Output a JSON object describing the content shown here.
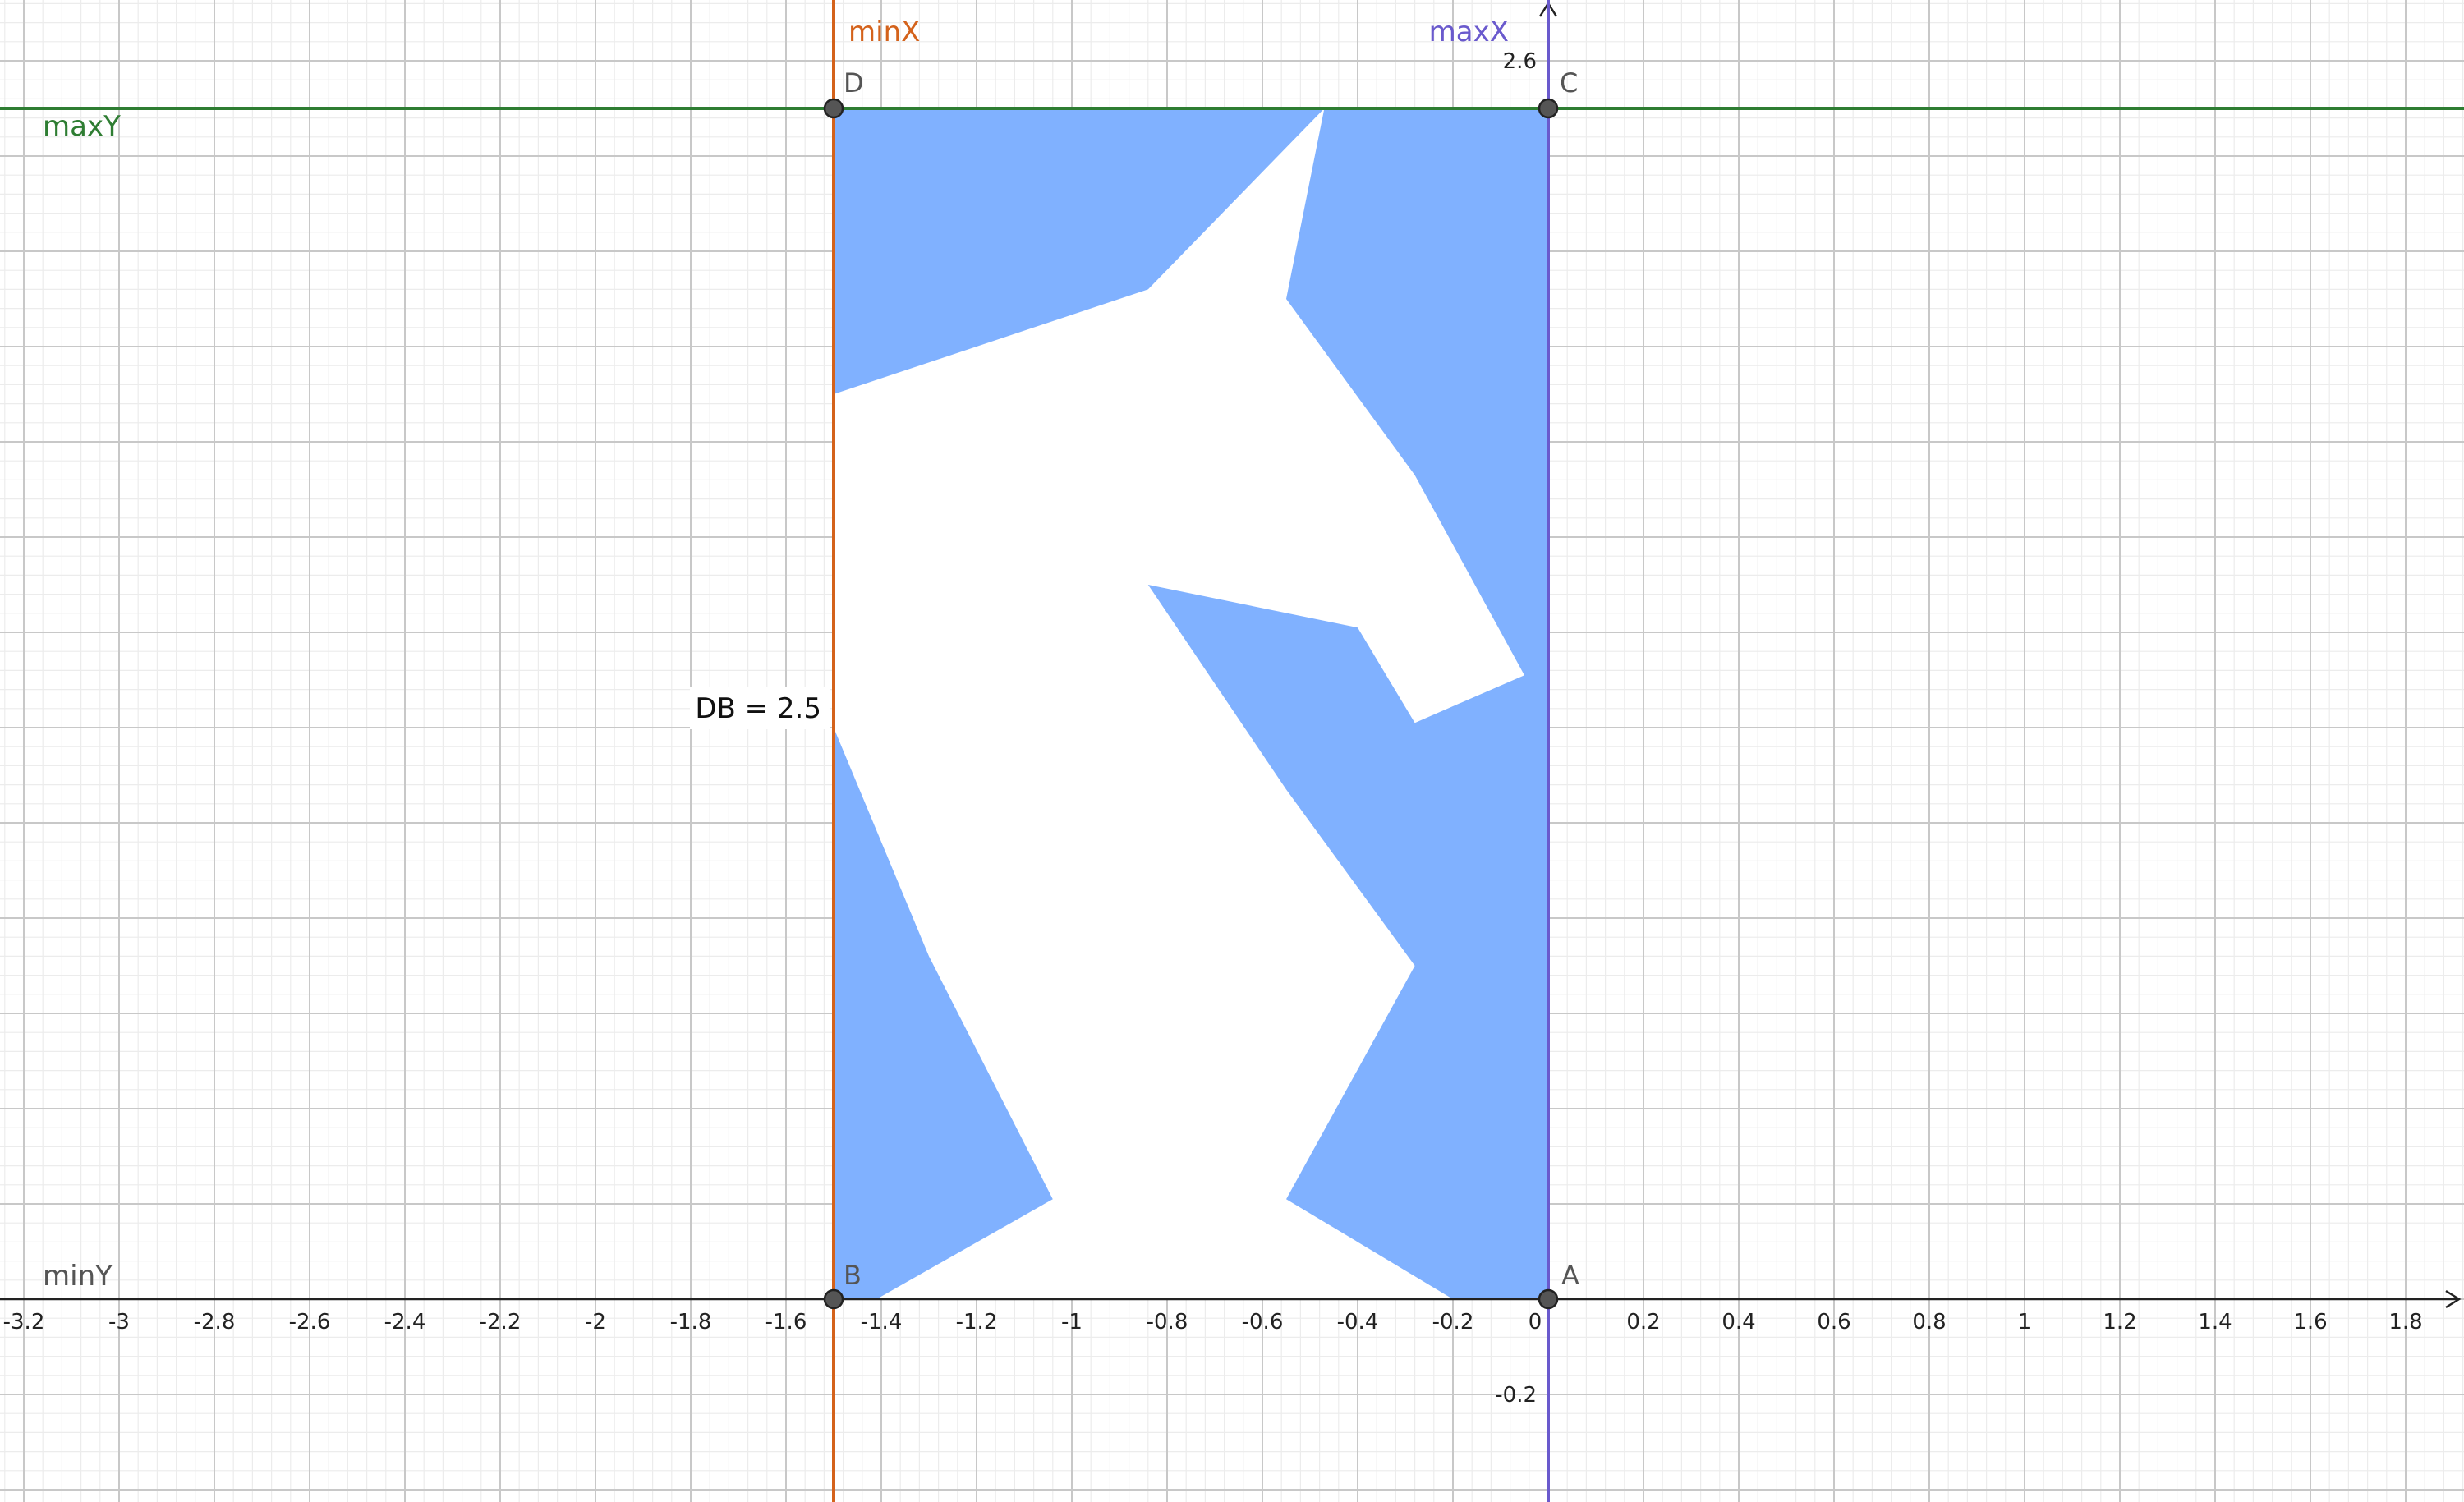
{
  "app": "GeoGebra graphing view",
  "axis_ticks": {
    "x": [
      "-3.2",
      "-3",
      "-2.8",
      "-2.6",
      "-2.4",
      "-2.2",
      "-2",
      "-1.8",
      "-1.6",
      "-1.4",
      "-1.2",
      "-1",
      "-0.8",
      "-0.6",
      "-0.4",
      "-0.2",
      "0",
      "0.2",
      "0.4",
      "0.6",
      "0.8",
      "1",
      "1.2",
      "1.4",
      "1.6",
      "1.8"
    ],
    "y": [
      "2.6",
      "-0.2"
    ]
  },
  "lines": {
    "minX": {
      "label": "minX",
      "color": "#d4621b"
    },
    "maxX": {
      "label": "maxX",
      "color": "#6a5acd"
    },
    "maxY": {
      "label": "maxY",
      "color": "#2e7d32"
    },
    "minY": {
      "label": "minY",
      "color": "#555555"
    }
  },
  "points": {
    "A": {
      "label": "A",
      "x": 0,
      "y": 0
    },
    "B": {
      "label": "B",
      "x": -1.5,
      "y": 0
    },
    "C": {
      "label": "C",
      "x": 0,
      "y": 2.5
    },
    "D": {
      "label": "D",
      "x": -1.5,
      "y": 2.5
    }
  },
  "segment_label": "DB = 2.5",
  "colors": {
    "fill": "#80b1ff",
    "grid_major": "#c8c8c8",
    "grid_minor": "#ececec",
    "axis": "#222222",
    "point": "#555555"
  },
  "region": {
    "shape": "horse-head knight silhouette in white over blue rectangle from x=-1.5 to x=0, y=0 to y=2.5",
    "white_shape_vertices": [
      [
        -1.5,
        1.9
      ],
      [
        -0.84,
        2.12
      ],
      [
        -0.47,
        2.5
      ],
      [
        -0.55,
        2.1
      ],
      [
        -0.28,
        1.73
      ],
      [
        -0.05,
        1.31
      ],
      [
        -0.28,
        1.21
      ],
      [
        -0.4,
        1.41
      ],
      [
        -0.84,
        1.5
      ],
      [
        -0.55,
        1.07
      ],
      [
        -0.28,
        0.7
      ],
      [
        -0.55,
        0.21
      ],
      [
        -0.2,
        0
      ],
      [
        -1.41,
        0
      ],
      [
        -1.04,
        0.21
      ],
      [
        -1.3,
        0.72
      ],
      [
        -1.5,
        1.2
      ]
    ]
  }
}
